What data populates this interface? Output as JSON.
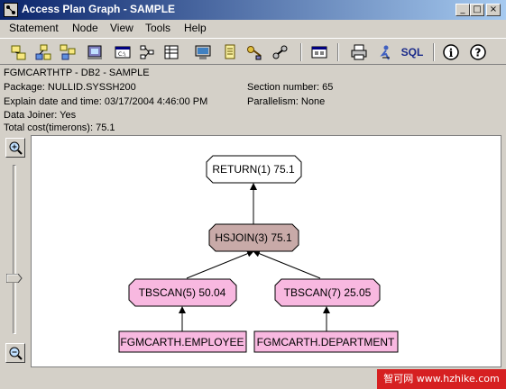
{
  "window": {
    "title": "Access Plan Graph - SAMPLE",
    "min": "_",
    "max": "□",
    "close": "×"
  },
  "menu": [
    "Statement",
    "Node",
    "View",
    "Tools",
    "Help"
  ],
  "toolbar": {
    "sql_label": "SQL",
    "info_label": "i",
    "help_label": "?"
  },
  "info": {
    "header": "FGMCARTHTP - DB2 - SAMPLE",
    "package": "Package: NULLID.SYSSH200",
    "explain_date": "Explain date and time: 03/17/2004 4:46:00 PM",
    "data_joiner": "Data Joiner: Yes",
    "total_cost": "Total cost(timerons): 75.1",
    "section_number": "Section number: 65",
    "parallelism": "Parallelism: None"
  },
  "graph": {
    "return_node": "RETURN(1) 75.1",
    "hsjoin_node": "HSJOIN(3) 75.1",
    "tbscan5_node": "TBSCAN(5) 50.04",
    "tbscan7_node": "TBSCAN(7) 25.05",
    "employee_table": "FGMCARTH.EMPLOYEE",
    "department_table": "FGMCARTH.DEPARTMENT"
  },
  "colors": {
    "return_fill": "#ffffff",
    "hsjoin_fill": "#c8aaa8",
    "tbscan_fill": "#f8b8e0",
    "table_fill": "#f8b8e0",
    "watermark": "#d62021"
  },
  "watermark": "智可网 www.hzhike.com"
}
